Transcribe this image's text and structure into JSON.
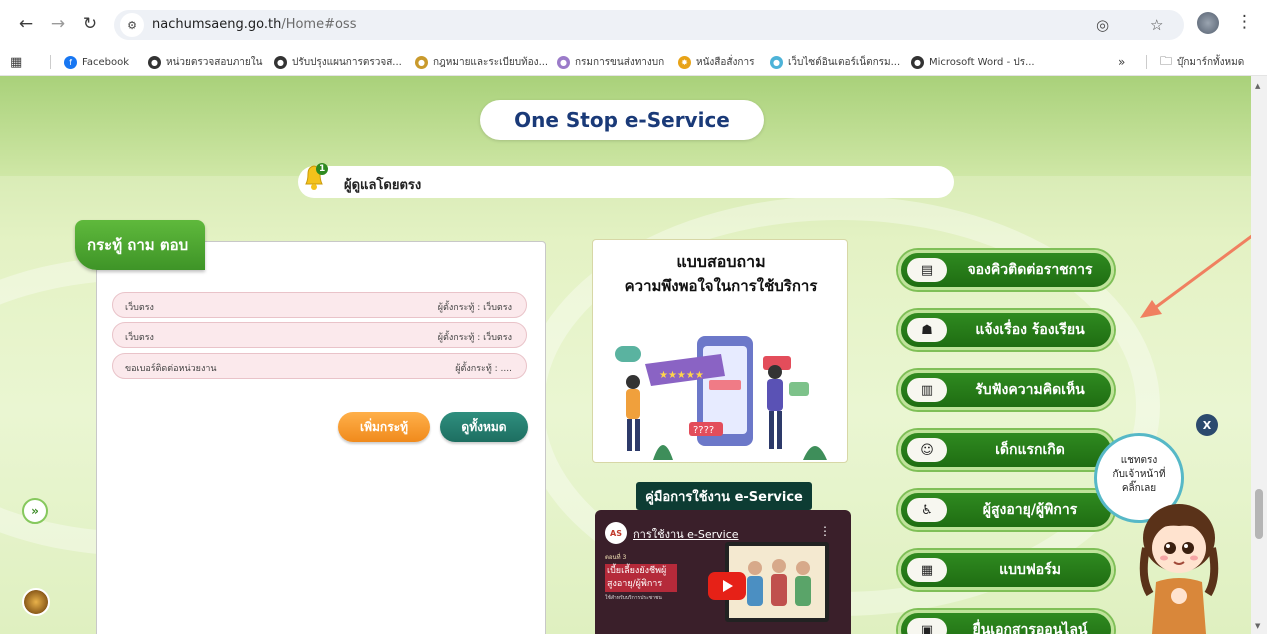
{
  "browser": {
    "url_host": "nachumsaeng.go.th",
    "url_path": "/Home#oss",
    "bookmarks": [
      "Facebook",
      "หน่วยตรวจสอบภายใน",
      "ปรับปรุงแผนการตรวจส...",
      "กฎหมายและระเบียบท้อง...",
      "กรมการขนส่งทางบก",
      "หนังสือสั่งการ",
      "เว็บไซต์อินเตอร์เน็ตกรม...",
      "Microsoft Word - ปร..."
    ],
    "more_bookmarks": "»",
    "all_bookmarks": "บุ๊กมาร์กทั้งหมด"
  },
  "page": {
    "title": "One Stop e-Service",
    "marquee_text": "ผู้ดูแลโดยตรง",
    "bell_badge": "1",
    "qa": {
      "tab_label": "กระทู้ ถาม ตอบ",
      "rows": [
        {
          "question": "เว็บตรง",
          "by": "ผู้ตั้งกระทู้ : เว็บตรง"
        },
        {
          "question": "เว็บตรง",
          "by": "ผู้ตั้งกระทู้ : เว็บตรง"
        },
        {
          "question": "ขอเบอร์ติดต่อหน่วยงาน",
          "by": "ผู้ตั้งกระทู้ : ...."
        }
      ],
      "add_button": "เพิ่มกระทู้",
      "view_all_button": "ดูทั้งหมด"
    },
    "survey": {
      "line1": "แบบสอบถาม",
      "line2": "ความพึงพอใจในการใช้บริการ"
    },
    "manual": {
      "label": "คู่มือการใช้งาน e-Service",
      "video_title": "การใช้งาน e-Service",
      "video_logo": "AS",
      "video_episode": "ตอนที่ 3",
      "video_heading": "เบี้ยเลี้ยงยังชีพผู้สูงอายุ/ผู้พิการ",
      "video_caption": "ใช้สำหรับบริการประชาชน"
    },
    "services": [
      {
        "label": "จองคิวติดต่อราชการ",
        "icon": "queue-icon"
      },
      {
        "label": "แจ้งเรื่อง ร้องเรียน",
        "icon": "complaint-icon"
      },
      {
        "label": "รับฟังความคิดเห็น",
        "icon": "opinion-icon"
      },
      {
        "label": "เด็กแรกเกิด",
        "icon": "newborn-icon"
      },
      {
        "label": "ผู้สูงอายุ/ผู้พิการ",
        "icon": "elderly-icon"
      },
      {
        "label": "แบบฟอร์ม",
        "icon": "form-icon"
      },
      {
        "label": "ยื่นเอกสารออนไลน์",
        "icon": "upload-icon"
      }
    ],
    "chat": {
      "line1": "แชทตรง",
      "line2": "กับเจ้าหน้าที่",
      "line3": "คลิ๊กเลย",
      "close": "X"
    }
  },
  "colors": {
    "service_green": "#2f8a20",
    "title_blue": "#1a3a78",
    "tab_green": "#4fa832",
    "add_orange": "#f39a2a",
    "view_teal": "#1f7a6a",
    "pointer_arrow": "#f08060"
  }
}
